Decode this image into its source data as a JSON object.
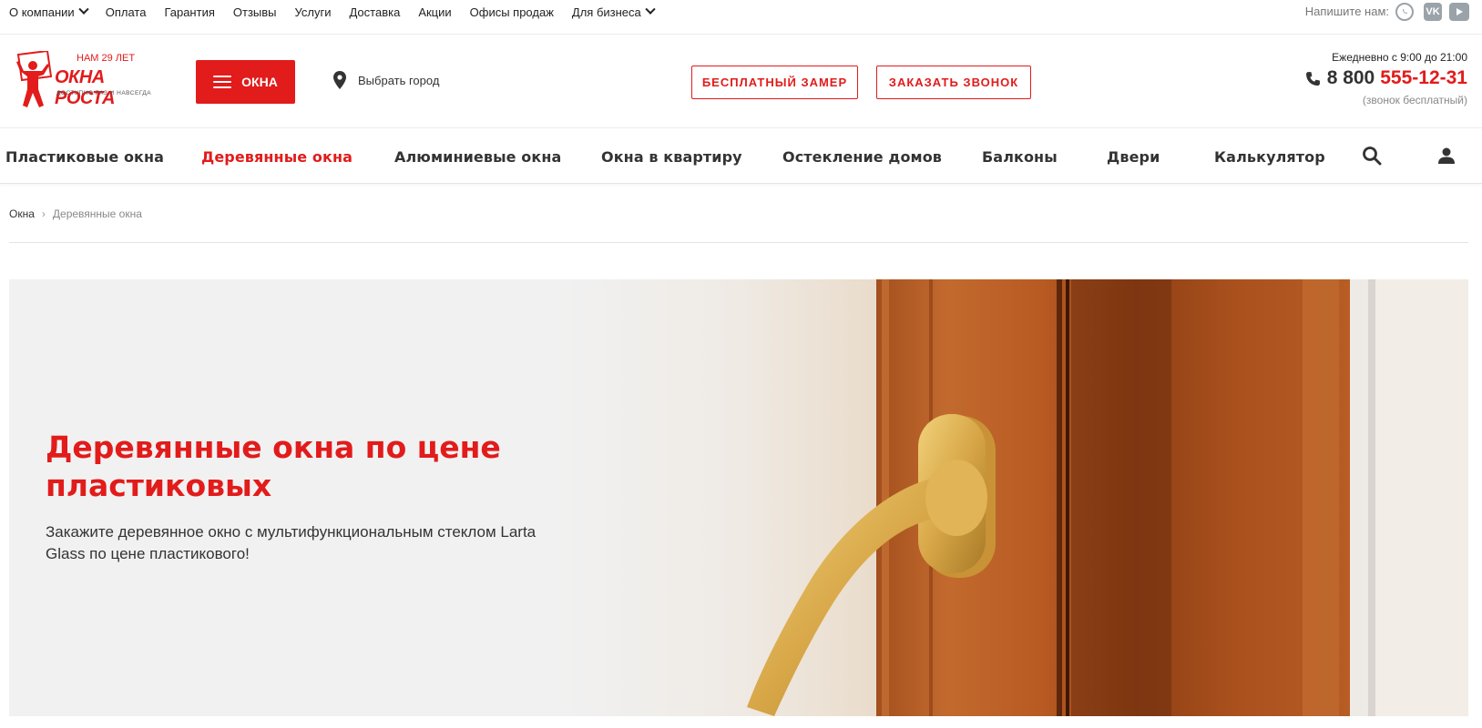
{
  "topbar": {
    "links": [
      {
        "label": "О компании",
        "dropdown": true
      },
      {
        "label": "Оплата",
        "dropdown": false
      },
      {
        "label": "Гарантия",
        "dropdown": false
      },
      {
        "label": "Отзывы",
        "dropdown": false
      },
      {
        "label": "Услуги",
        "dropdown": false
      },
      {
        "label": "Доставка",
        "dropdown": false
      },
      {
        "label": "Акции",
        "dropdown": false
      },
      {
        "label": "Офисы продаж",
        "dropdown": false
      },
      {
        "label": "Для бизнеса",
        "dropdown": true
      }
    ],
    "write_us": "Напишите нам:",
    "social": [
      "whatsapp-icon",
      "vk-icon",
      "youtube-icon"
    ]
  },
  "header": {
    "logo": {
      "years": "НАМ 29 ЛЕТ",
      "brand": "ОКНА РОСТА",
      "tagline": "ДОСТУПНО РАЗ И НАВСЕГДА"
    },
    "menu_button": "ОКНА",
    "city": "Выбрать город",
    "btn_measure": "БЕСПЛАТНЫЙ ЗАМЕР",
    "btn_call": "ЗАКАЗАТЬ ЗВОНОК",
    "schedule": "Ежедневно с 9:00 до 21:00",
    "phone_prefix": "8 800",
    "phone_number": "555-12-31",
    "phone_note": "(звонок бесплатный)"
  },
  "nav": {
    "items": [
      {
        "label": "Пластиковые окна",
        "active": false
      },
      {
        "label": "Деревянные окна",
        "active": true
      },
      {
        "label": "Алюминиевые окна",
        "active": false
      },
      {
        "label": "Окна в квартиру",
        "active": false
      },
      {
        "label": "Остекление домов",
        "active": false
      },
      {
        "label": "Балконы",
        "active": false
      },
      {
        "label": "Двери",
        "active": false
      },
      {
        "label": "Калькулятор",
        "active": false
      }
    ]
  },
  "breadcrumbs": {
    "root": "Окна",
    "separator": "›",
    "current": "Деревянные окна"
  },
  "hero": {
    "title": "Деревянные окна по цене пластиковых",
    "text": "Закажите деревянное окно с мультифункциональным стеклом Larta Glass по цене пластикового!"
  },
  "colors": {
    "accent": "#e21b1b",
    "text": "#333333",
    "muted": "#888888"
  }
}
